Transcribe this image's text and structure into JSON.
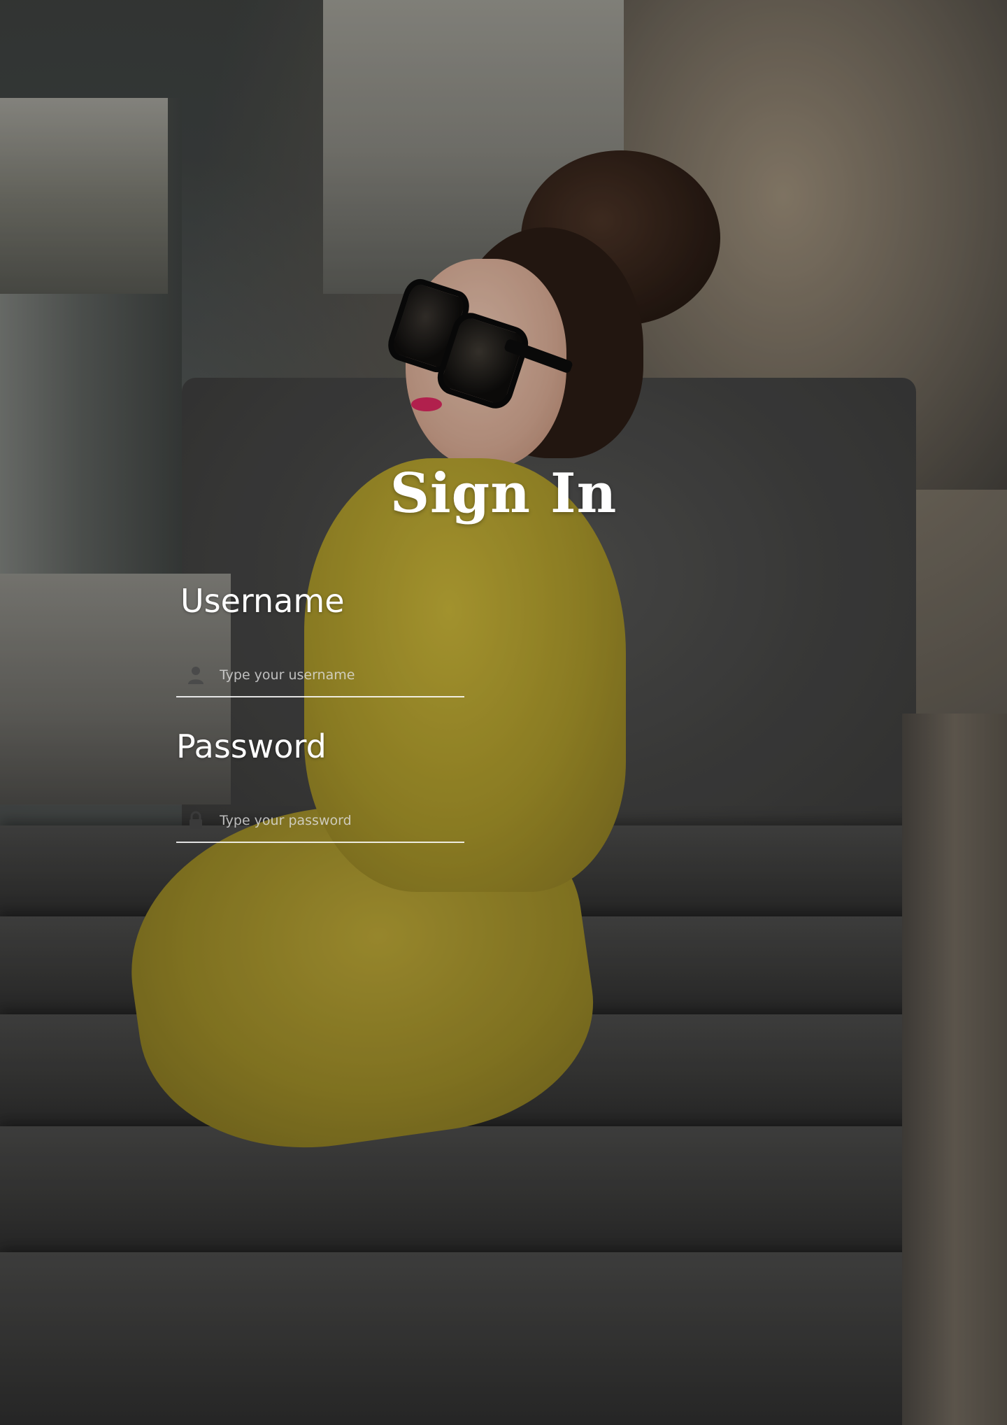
{
  "title": "Sign In",
  "form": {
    "username": {
      "label": "Username",
      "placeholder": "Type your username",
      "icon": "user-icon"
    },
    "password": {
      "label": "Password",
      "placeholder": "Type your password",
      "icon": "lock-icon"
    }
  },
  "colors": {
    "text": "#ffffff",
    "underline": "#ffffff",
    "placeholder": "#e1e1e1"
  }
}
